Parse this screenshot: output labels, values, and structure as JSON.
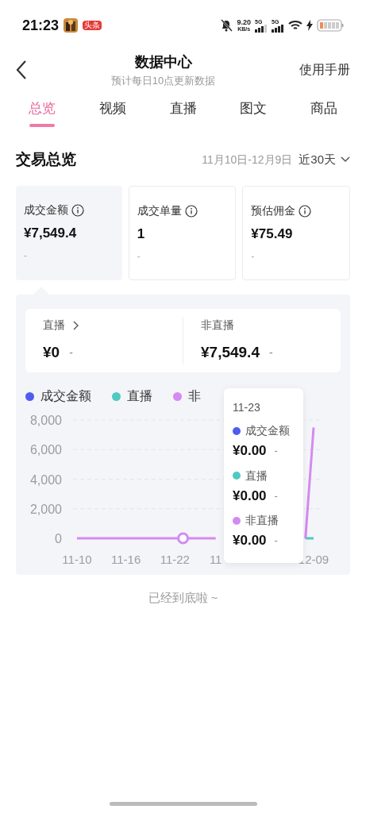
{
  "status_bar": {
    "time": "21:23",
    "badge": "头条",
    "net_speed": "9.20",
    "net_unit": "KB/s",
    "signal_labels": [
      "5G",
      "5G"
    ]
  },
  "header": {
    "title": "数据中心",
    "subtitle": "预计每日10点更新数据",
    "action": "使用手册"
  },
  "tabs": [
    {
      "label": "总览",
      "selected": true
    },
    {
      "label": "视频",
      "selected": false
    },
    {
      "label": "直播",
      "selected": false
    },
    {
      "label": "图文",
      "selected": false
    },
    {
      "label": "商品",
      "selected": false
    }
  ],
  "section": {
    "title": "交易总览",
    "date_range": "11月10日-12月9日",
    "period": "近30天"
  },
  "metrics": [
    {
      "label": "成交金额",
      "value": "¥7,549.4",
      "change": "-",
      "selected": true
    },
    {
      "label": "成交单量",
      "value": "1",
      "change": "-",
      "selected": false
    },
    {
      "label": "预估佣金",
      "value": "¥75.49",
      "change": "-",
      "selected": false
    }
  ],
  "breakdown": [
    {
      "label": "直播",
      "value": "¥0",
      "change": "-",
      "link": true
    },
    {
      "label": "非直播",
      "value": "¥7,549.4",
      "change": "-",
      "link": false
    }
  ],
  "chart_data": {
    "type": "line",
    "categories": [
      "11-10",
      null,
      null,
      null,
      null,
      null,
      "11-16",
      null,
      null,
      null,
      null,
      null,
      "11-22",
      null,
      null,
      null,
      null,
      "11",
      null,
      null,
      null,
      null,
      null,
      null,
      null,
      null,
      null,
      null,
      null,
      "12-09"
    ],
    "series": [
      {
        "name": "成交金额",
        "color": "#4e5cf2",
        "values": [
          null,
          null,
          null,
          null,
          null,
          null,
          null,
          null,
          null,
          null,
          null,
          null,
          null,
          null,
          null,
          null,
          null,
          null,
          null,
          null,
          null,
          null,
          null,
          null,
          null,
          null,
          null,
          null,
          null,
          null
        ]
      },
      {
        "name": "直播",
        "color": "#4ecac2",
        "values": [
          null,
          null,
          null,
          null,
          null,
          null,
          null,
          null,
          null,
          null,
          null,
          null,
          null,
          null,
          null,
          null,
          null,
          null,
          null,
          null,
          null,
          null,
          null,
          null,
          null,
          null,
          null,
          null,
          0,
          0
        ]
      },
      {
        "name": "非",
        "color": "#d48af2",
        "values": [
          0,
          0,
          0,
          0,
          0,
          0,
          0,
          0,
          0,
          0,
          0,
          0,
          0,
          0,
          0,
          0,
          0,
          0,
          null,
          null,
          null,
          null,
          null,
          null,
          null,
          null,
          null,
          null,
          0,
          7500
        ]
      }
    ],
    "ylim": [
      0,
      8000
    ],
    "grid": true,
    "yticks": [
      {
        "value": 0,
        "label": "0"
      },
      {
        "value": 2000,
        "label": "2,000"
      },
      {
        "value": 4000,
        "label": "4,000"
      },
      {
        "value": 6000,
        "label": "6,000"
      },
      {
        "value": 8000,
        "label": "8,000"
      }
    ]
  },
  "tooltip": {
    "date": "11-23",
    "items": [
      {
        "label": "成交金额",
        "value": "¥0.00",
        "change": "-",
        "color": "#4e5cf2"
      },
      {
        "label": "直播",
        "value": "¥0.00",
        "change": "-",
        "color": "#4ecac2"
      },
      {
        "label": "非直播",
        "value": "¥0.00",
        "change": "-",
        "color": "#d48af2"
      }
    ]
  },
  "footer": "已经到底啦 ~"
}
